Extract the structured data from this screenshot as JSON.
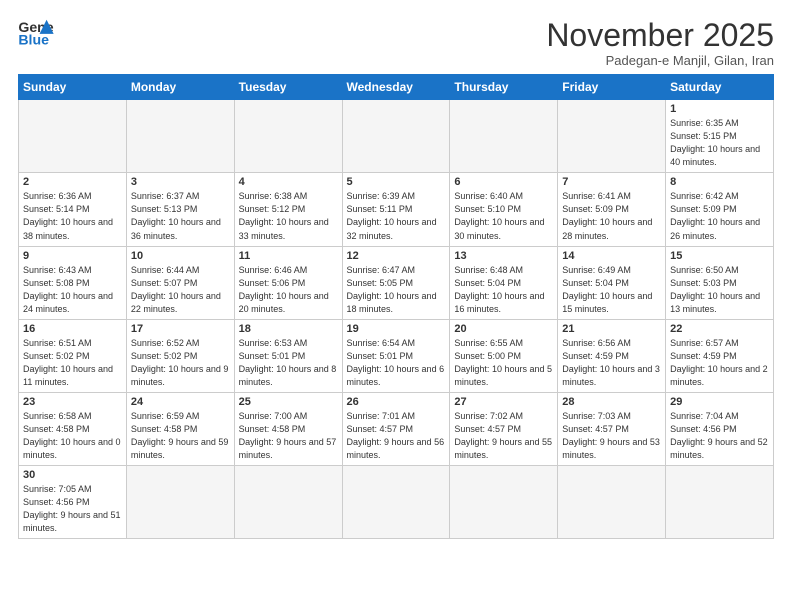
{
  "logo": {
    "text_general": "General",
    "text_blue": "Blue"
  },
  "header": {
    "month": "November 2025",
    "location": "Padegan-e Manjil, Gilan, Iran"
  },
  "days_of_week": [
    "Sunday",
    "Monday",
    "Tuesday",
    "Wednesday",
    "Thursday",
    "Friday",
    "Saturday"
  ],
  "weeks": [
    [
      {
        "day": "",
        "info": ""
      },
      {
        "day": "",
        "info": ""
      },
      {
        "day": "",
        "info": ""
      },
      {
        "day": "",
        "info": ""
      },
      {
        "day": "",
        "info": ""
      },
      {
        "day": "",
        "info": ""
      },
      {
        "day": "1",
        "info": "Sunrise: 6:35 AM\nSunset: 5:15 PM\nDaylight: 10 hours\nand 40 minutes."
      }
    ],
    [
      {
        "day": "2",
        "info": "Sunrise: 6:36 AM\nSunset: 5:14 PM\nDaylight: 10 hours\nand 38 minutes."
      },
      {
        "day": "3",
        "info": "Sunrise: 6:37 AM\nSunset: 5:13 PM\nDaylight: 10 hours\nand 36 minutes."
      },
      {
        "day": "4",
        "info": "Sunrise: 6:38 AM\nSunset: 5:12 PM\nDaylight: 10 hours\nand 33 minutes."
      },
      {
        "day": "5",
        "info": "Sunrise: 6:39 AM\nSunset: 5:11 PM\nDaylight: 10 hours\nand 32 minutes."
      },
      {
        "day": "6",
        "info": "Sunrise: 6:40 AM\nSunset: 5:10 PM\nDaylight: 10 hours\nand 30 minutes."
      },
      {
        "day": "7",
        "info": "Sunrise: 6:41 AM\nSunset: 5:09 PM\nDaylight: 10 hours\nand 28 minutes."
      },
      {
        "day": "8",
        "info": "Sunrise: 6:42 AM\nSunset: 5:09 PM\nDaylight: 10 hours\nand 26 minutes."
      }
    ],
    [
      {
        "day": "9",
        "info": "Sunrise: 6:43 AM\nSunset: 5:08 PM\nDaylight: 10 hours\nand 24 minutes."
      },
      {
        "day": "10",
        "info": "Sunrise: 6:44 AM\nSunset: 5:07 PM\nDaylight: 10 hours\nand 22 minutes."
      },
      {
        "day": "11",
        "info": "Sunrise: 6:46 AM\nSunset: 5:06 PM\nDaylight: 10 hours\nand 20 minutes."
      },
      {
        "day": "12",
        "info": "Sunrise: 6:47 AM\nSunset: 5:05 PM\nDaylight: 10 hours\nand 18 minutes."
      },
      {
        "day": "13",
        "info": "Sunrise: 6:48 AM\nSunset: 5:04 PM\nDaylight: 10 hours\nand 16 minutes."
      },
      {
        "day": "14",
        "info": "Sunrise: 6:49 AM\nSunset: 5:04 PM\nDaylight: 10 hours\nand 15 minutes."
      },
      {
        "day": "15",
        "info": "Sunrise: 6:50 AM\nSunset: 5:03 PM\nDaylight: 10 hours\nand 13 minutes."
      }
    ],
    [
      {
        "day": "16",
        "info": "Sunrise: 6:51 AM\nSunset: 5:02 PM\nDaylight: 10 hours\nand 11 minutes."
      },
      {
        "day": "17",
        "info": "Sunrise: 6:52 AM\nSunset: 5:02 PM\nDaylight: 10 hours\nand 9 minutes."
      },
      {
        "day": "18",
        "info": "Sunrise: 6:53 AM\nSunset: 5:01 PM\nDaylight: 10 hours\nand 8 minutes."
      },
      {
        "day": "19",
        "info": "Sunrise: 6:54 AM\nSunset: 5:01 PM\nDaylight: 10 hours\nand 6 minutes."
      },
      {
        "day": "20",
        "info": "Sunrise: 6:55 AM\nSunset: 5:00 PM\nDaylight: 10 hours\nand 5 minutes."
      },
      {
        "day": "21",
        "info": "Sunrise: 6:56 AM\nSunset: 4:59 PM\nDaylight: 10 hours\nand 3 minutes."
      },
      {
        "day": "22",
        "info": "Sunrise: 6:57 AM\nSunset: 4:59 PM\nDaylight: 10 hours\nand 2 minutes."
      }
    ],
    [
      {
        "day": "23",
        "info": "Sunrise: 6:58 AM\nSunset: 4:58 PM\nDaylight: 10 hours\nand 0 minutes."
      },
      {
        "day": "24",
        "info": "Sunrise: 6:59 AM\nSunset: 4:58 PM\nDaylight: 9 hours\nand 59 minutes."
      },
      {
        "day": "25",
        "info": "Sunrise: 7:00 AM\nSunset: 4:58 PM\nDaylight: 9 hours\nand 57 minutes."
      },
      {
        "day": "26",
        "info": "Sunrise: 7:01 AM\nSunset: 4:57 PM\nDaylight: 9 hours\nand 56 minutes."
      },
      {
        "day": "27",
        "info": "Sunrise: 7:02 AM\nSunset: 4:57 PM\nDaylight: 9 hours\nand 55 minutes."
      },
      {
        "day": "28",
        "info": "Sunrise: 7:03 AM\nSunset: 4:57 PM\nDaylight: 9 hours\nand 53 minutes."
      },
      {
        "day": "29",
        "info": "Sunrise: 7:04 AM\nSunset: 4:56 PM\nDaylight: 9 hours\nand 52 minutes."
      }
    ],
    [
      {
        "day": "30",
        "info": "Sunrise: 7:05 AM\nSunset: 4:56 PM\nDaylight: 9 hours\nand 51 minutes."
      },
      {
        "day": "",
        "info": ""
      },
      {
        "day": "",
        "info": ""
      },
      {
        "day": "",
        "info": ""
      },
      {
        "day": "",
        "info": ""
      },
      {
        "day": "",
        "info": ""
      },
      {
        "day": "",
        "info": ""
      }
    ]
  ]
}
